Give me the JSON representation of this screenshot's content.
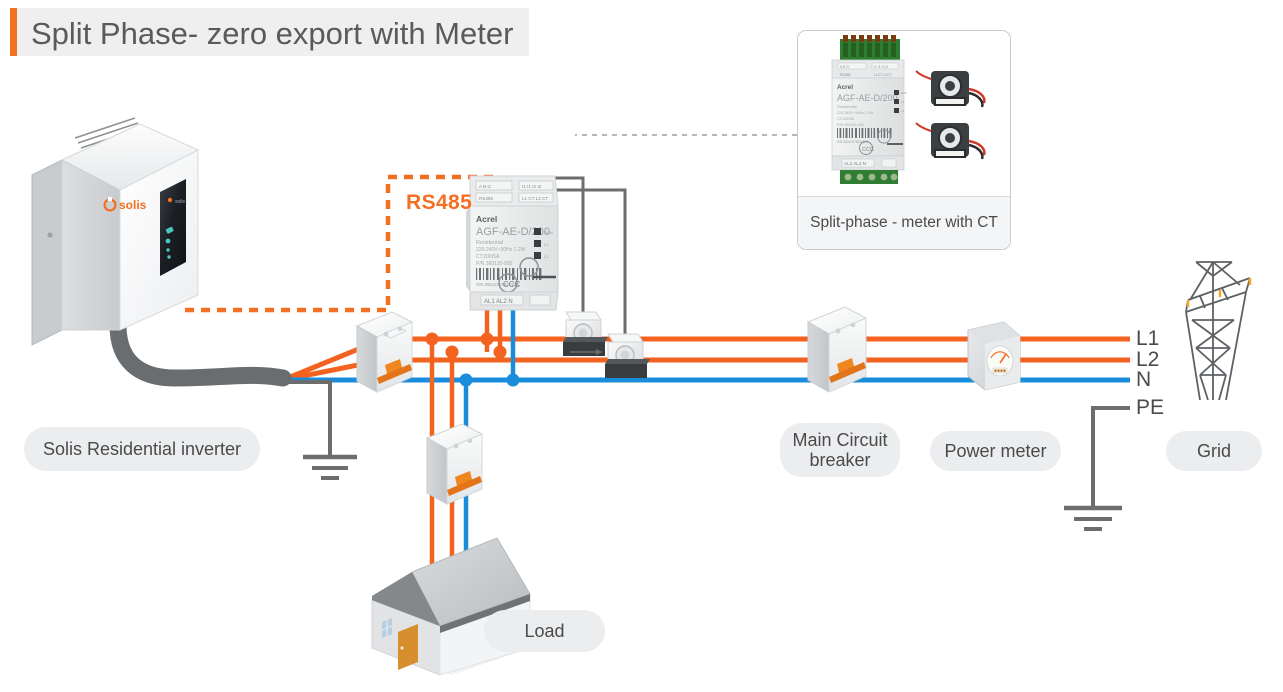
{
  "title": "Split Phase- zero export with Meter",
  "accent_color": "#F36F21",
  "colors": {
    "line_L1": "#F4621F",
    "line_L2": "#F4621F",
    "line_N": "#1A8CDC",
    "line_PE": "#6d6d6d",
    "comm_rs485": "#F36F21",
    "title_bar": "#F36F21",
    "pill_bg": "#ebedef",
    "text": "#4a4a4a"
  },
  "inset": {
    "caption": "Split-phase - meter with CT",
    "device_brand": "Acrel",
    "device_model": "AGF-AE-D/200",
    "device_subtitle": "Residential",
    "device_spec_1": "220-240V~50Hz 1.2W",
    "device_spec_2": "CT:200/5A",
    "device_spec_3": "P/N 360120-000",
    "terminal_label": "AL1 AL2  N",
    "led_labels": [
      "RUN",
      "L1",
      "L2"
    ],
    "ct_count": 2
  },
  "meter": {
    "brand": "Acrel",
    "model": "AGF-AE-D/200",
    "subtitle": "Residential",
    "spec_1": "220-240V~50Hz 1.2W",
    "spec_2": "CT:200/5A",
    "spec_3": "P/N 360120-000",
    "top_left_terminal": "A  B  G",
    "top_left_caption": "RS485",
    "top_right_terminal": "I1  I1  I2  I2",
    "top_right_caption": "L1 CT   L2 CT",
    "bottom_terminal": "AL1 AL2  N",
    "led_labels": [
      "RUN",
      "L1",
      "L2"
    ]
  },
  "comm": {
    "rs485_label": "RS485"
  },
  "legend": [
    {
      "label": "L1",
      "color": "#F4621F"
    },
    {
      "label": "L2",
      "color": "#F4621F"
    },
    {
      "label": "N",
      "color": "#1A8CDC"
    },
    {
      "label": "PE",
      "color": "#6d6d6d"
    }
  ],
  "pills": {
    "inverter": "Solis Residential inverter",
    "main_breaker": "Main Circuit\nbreaker",
    "main_breaker_line1": "Main Circuit",
    "main_breaker_line2": "breaker",
    "power_meter": "Power meter",
    "grid": "Grid",
    "load": "Load"
  },
  "devices": {
    "inverter_brand": "solis",
    "ct_on_line_count": 2,
    "breaker_count": 3,
    "ground_symbol_count": 2
  }
}
